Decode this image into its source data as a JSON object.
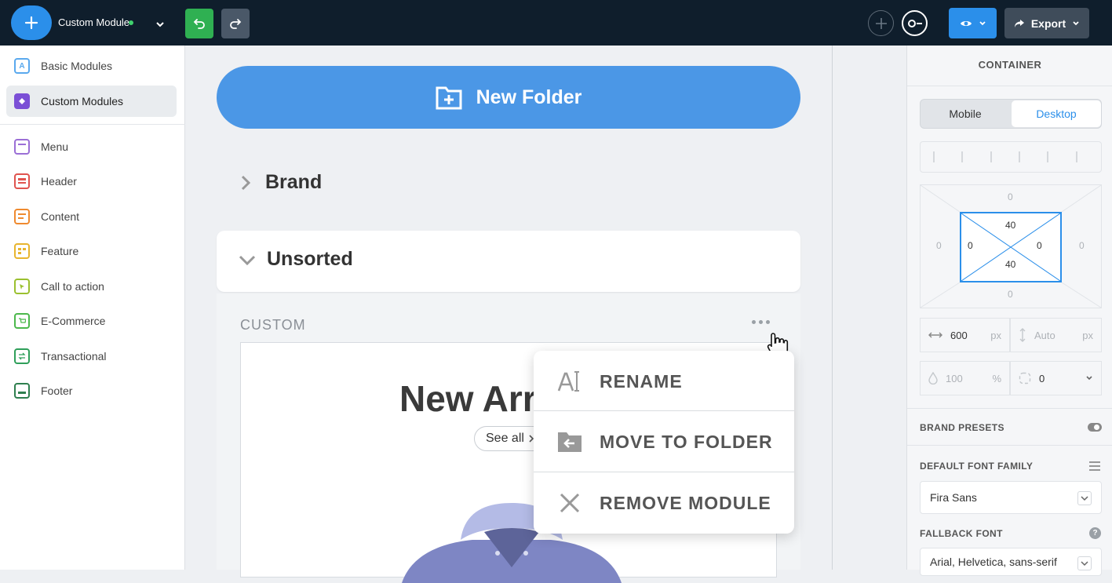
{
  "topbar": {
    "module_name": "Custom Module",
    "export_label": "Export"
  },
  "sidebar": {
    "items": [
      {
        "label": "Basic Modules",
        "icon": "A",
        "color": "#2b8fea"
      },
      {
        "label": "Custom Modules",
        "icon": "custom-modules-icon",
        "color": "#7b4fd6"
      },
      {
        "label": "Menu",
        "icon": "menu-icon",
        "color": "#9b5fd6"
      },
      {
        "label": "Header",
        "icon": "header-icon",
        "color": "#e0544f"
      },
      {
        "label": "Content",
        "icon": "content-icon",
        "color": "#ef8a2f"
      },
      {
        "label": "Feature",
        "icon": "feature-icon",
        "color": "#e8b52f"
      },
      {
        "label": "Call to action",
        "icon": "cta-icon",
        "color": "#9bc02f"
      },
      {
        "label": "E-Commerce",
        "icon": "cart-icon",
        "color": "#4cb84c"
      },
      {
        "label": "Transactional",
        "icon": "transactional-icon",
        "color": "#2f9f5a"
      },
      {
        "label": "Footer",
        "icon": "footer-icon",
        "color": "#2f7f4f"
      }
    ]
  },
  "canvas": {
    "new_folder_label": "New Folder",
    "brand_folder": "Brand",
    "unsorted_folder": "Unsorted",
    "custom_section": "CUSTOM",
    "preview_title": "New Arr",
    "see_all": "See all"
  },
  "context_menu": {
    "items": [
      "RENAME",
      "MOVE TO FOLDER",
      "REMOVE MODULE"
    ]
  },
  "right_panel": {
    "title": "CONTAINER",
    "tabs": [
      "Mobile",
      "Desktop"
    ],
    "padding": {
      "outer_top": "0",
      "outer_bottom": "0",
      "outer_left": "0",
      "outer_right": "0",
      "inner_top": "40",
      "inner_bottom": "40",
      "inner_left": "0",
      "inner_right": "0"
    },
    "width_value": "600",
    "width_unit": "px",
    "height_value": "Auto",
    "height_unit": "px",
    "opacity_value": "100",
    "opacity_unit": "%",
    "radius_value": "0",
    "brand_presets_label": "BRAND PRESETS",
    "default_font_label": "DEFAULT FONT FAMILY",
    "default_font_value": "Fira Sans",
    "fallback_font_label": "FALLBACK FONT",
    "fallback_font_value": "Arial, Helvetica, sans-serif"
  },
  "colors": {
    "accent": "#2b8fea",
    "topbar": "#0f1e2c",
    "undo": "#2fb052",
    "online": "#3fd26e"
  }
}
